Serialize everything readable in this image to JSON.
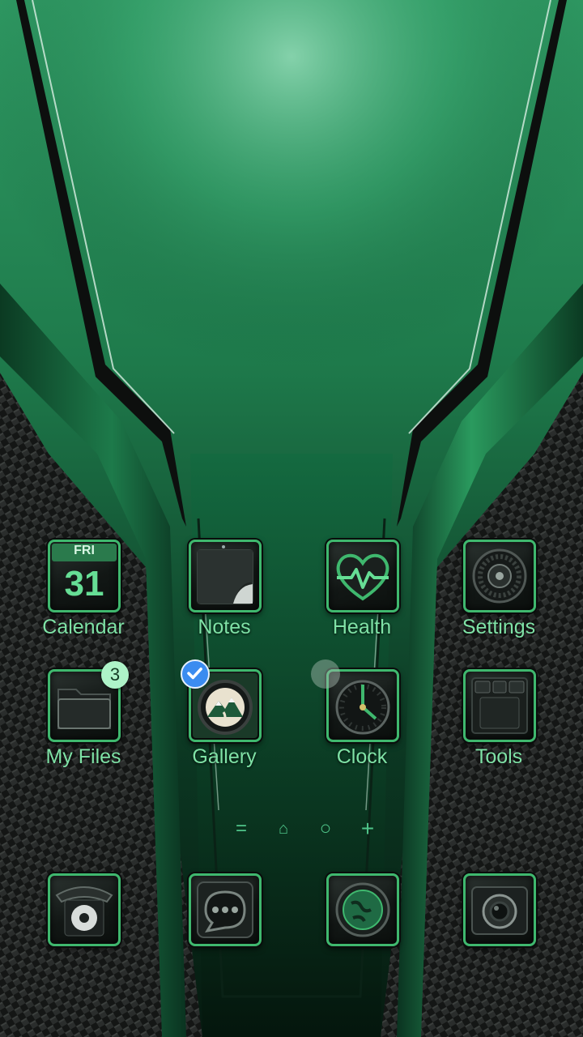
{
  "apps": {
    "calendar": {
      "label": "Calendar",
      "day": "FRI",
      "date": "31"
    },
    "notes": {
      "label": "Notes"
    },
    "health": {
      "label": "Health"
    },
    "settings": {
      "label": "Settings"
    },
    "my_files": {
      "label": "My Files",
      "badge": "3"
    },
    "gallery": {
      "label": "Gallery",
      "selected": true
    },
    "clock": {
      "label": "Clock"
    },
    "tools": {
      "label": "Tools"
    }
  },
  "page_indicator": {
    "items": [
      "=",
      "⌂",
      "○",
      "+"
    ],
    "icons": [
      "menu-lines-icon",
      "home-icon",
      "page-dot-icon",
      "add-page-icon"
    ]
  },
  "dock": {
    "items": [
      "phone-icon",
      "messages-icon",
      "browser-icon",
      "camera-icon"
    ]
  },
  "colors": {
    "accent": "#3fb86e",
    "label": "#7fe2a6",
    "badge": "#aef3c8",
    "check": "#3b8cf0"
  }
}
